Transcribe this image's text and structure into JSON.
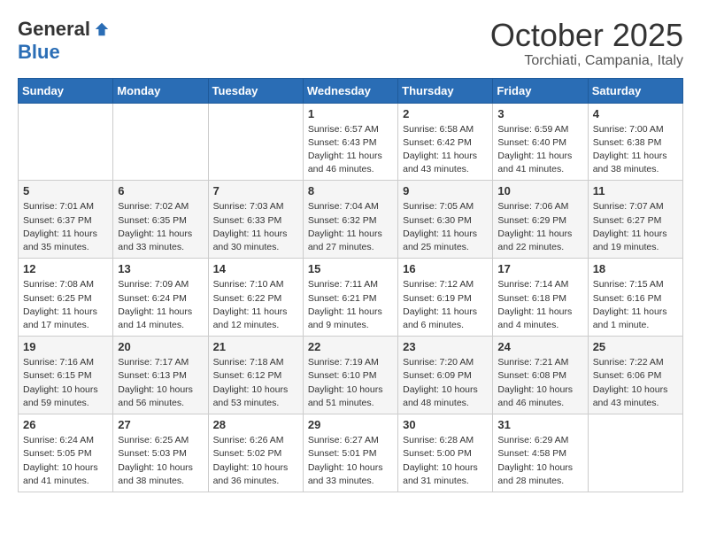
{
  "header": {
    "logo_general": "General",
    "logo_blue": "Blue",
    "month_year": "October 2025",
    "location": "Torchiati, Campania, Italy"
  },
  "days_of_week": [
    "Sunday",
    "Monday",
    "Tuesday",
    "Wednesday",
    "Thursday",
    "Friday",
    "Saturday"
  ],
  "weeks": [
    [
      {
        "day": "",
        "info": ""
      },
      {
        "day": "",
        "info": ""
      },
      {
        "day": "",
        "info": ""
      },
      {
        "day": "1",
        "info": "Sunrise: 6:57 AM\nSunset: 6:43 PM\nDaylight: 11 hours\nand 46 minutes."
      },
      {
        "day": "2",
        "info": "Sunrise: 6:58 AM\nSunset: 6:42 PM\nDaylight: 11 hours\nand 43 minutes."
      },
      {
        "day": "3",
        "info": "Sunrise: 6:59 AM\nSunset: 6:40 PM\nDaylight: 11 hours\nand 41 minutes."
      },
      {
        "day": "4",
        "info": "Sunrise: 7:00 AM\nSunset: 6:38 PM\nDaylight: 11 hours\nand 38 minutes."
      }
    ],
    [
      {
        "day": "5",
        "info": "Sunrise: 7:01 AM\nSunset: 6:37 PM\nDaylight: 11 hours\nand 35 minutes."
      },
      {
        "day": "6",
        "info": "Sunrise: 7:02 AM\nSunset: 6:35 PM\nDaylight: 11 hours\nand 33 minutes."
      },
      {
        "day": "7",
        "info": "Sunrise: 7:03 AM\nSunset: 6:33 PM\nDaylight: 11 hours\nand 30 minutes."
      },
      {
        "day": "8",
        "info": "Sunrise: 7:04 AM\nSunset: 6:32 PM\nDaylight: 11 hours\nand 27 minutes."
      },
      {
        "day": "9",
        "info": "Sunrise: 7:05 AM\nSunset: 6:30 PM\nDaylight: 11 hours\nand 25 minutes."
      },
      {
        "day": "10",
        "info": "Sunrise: 7:06 AM\nSunset: 6:29 PM\nDaylight: 11 hours\nand 22 minutes."
      },
      {
        "day": "11",
        "info": "Sunrise: 7:07 AM\nSunset: 6:27 PM\nDaylight: 11 hours\nand 19 minutes."
      }
    ],
    [
      {
        "day": "12",
        "info": "Sunrise: 7:08 AM\nSunset: 6:25 PM\nDaylight: 11 hours\nand 17 minutes."
      },
      {
        "day": "13",
        "info": "Sunrise: 7:09 AM\nSunset: 6:24 PM\nDaylight: 11 hours\nand 14 minutes."
      },
      {
        "day": "14",
        "info": "Sunrise: 7:10 AM\nSunset: 6:22 PM\nDaylight: 11 hours\nand 12 minutes."
      },
      {
        "day": "15",
        "info": "Sunrise: 7:11 AM\nSunset: 6:21 PM\nDaylight: 11 hours\nand 9 minutes."
      },
      {
        "day": "16",
        "info": "Sunrise: 7:12 AM\nSunset: 6:19 PM\nDaylight: 11 hours\nand 6 minutes."
      },
      {
        "day": "17",
        "info": "Sunrise: 7:14 AM\nSunset: 6:18 PM\nDaylight: 11 hours\nand 4 minutes."
      },
      {
        "day": "18",
        "info": "Sunrise: 7:15 AM\nSunset: 6:16 PM\nDaylight: 11 hours\nand 1 minute."
      }
    ],
    [
      {
        "day": "19",
        "info": "Sunrise: 7:16 AM\nSunset: 6:15 PM\nDaylight: 10 hours\nand 59 minutes."
      },
      {
        "day": "20",
        "info": "Sunrise: 7:17 AM\nSunset: 6:13 PM\nDaylight: 10 hours\nand 56 minutes."
      },
      {
        "day": "21",
        "info": "Sunrise: 7:18 AM\nSunset: 6:12 PM\nDaylight: 10 hours\nand 53 minutes."
      },
      {
        "day": "22",
        "info": "Sunrise: 7:19 AM\nSunset: 6:10 PM\nDaylight: 10 hours\nand 51 minutes."
      },
      {
        "day": "23",
        "info": "Sunrise: 7:20 AM\nSunset: 6:09 PM\nDaylight: 10 hours\nand 48 minutes."
      },
      {
        "day": "24",
        "info": "Sunrise: 7:21 AM\nSunset: 6:08 PM\nDaylight: 10 hours\nand 46 minutes."
      },
      {
        "day": "25",
        "info": "Sunrise: 7:22 AM\nSunset: 6:06 PM\nDaylight: 10 hours\nand 43 minutes."
      }
    ],
    [
      {
        "day": "26",
        "info": "Sunrise: 6:24 AM\nSunset: 5:05 PM\nDaylight: 10 hours\nand 41 minutes."
      },
      {
        "day": "27",
        "info": "Sunrise: 6:25 AM\nSunset: 5:03 PM\nDaylight: 10 hours\nand 38 minutes."
      },
      {
        "day": "28",
        "info": "Sunrise: 6:26 AM\nSunset: 5:02 PM\nDaylight: 10 hours\nand 36 minutes."
      },
      {
        "day": "29",
        "info": "Sunrise: 6:27 AM\nSunset: 5:01 PM\nDaylight: 10 hours\nand 33 minutes."
      },
      {
        "day": "30",
        "info": "Sunrise: 6:28 AM\nSunset: 5:00 PM\nDaylight: 10 hours\nand 31 minutes."
      },
      {
        "day": "31",
        "info": "Sunrise: 6:29 AM\nSunset: 4:58 PM\nDaylight: 10 hours\nand 28 minutes."
      },
      {
        "day": "",
        "info": ""
      }
    ]
  ]
}
